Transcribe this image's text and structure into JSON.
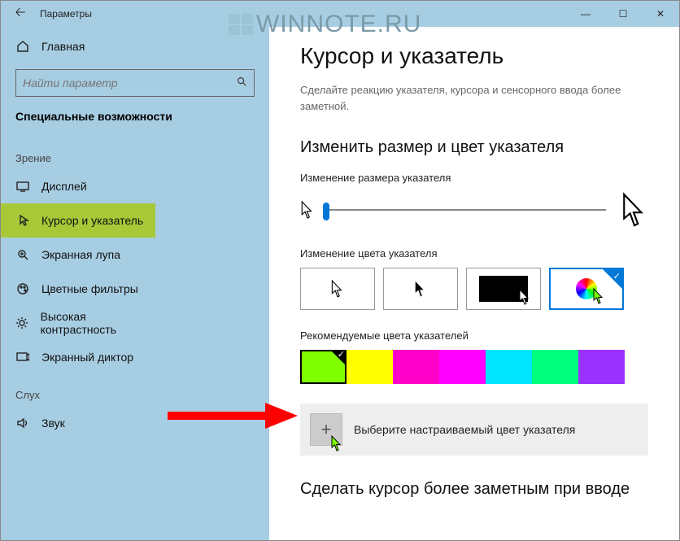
{
  "window": {
    "title": "Параметры"
  },
  "winbuttons": {
    "min": "—",
    "max": "☐",
    "close": "✕"
  },
  "sidebar": {
    "home": "Главная",
    "search_placeholder": "Найти параметр",
    "heading": "Специальные возможности",
    "sub_vision": "Зрение",
    "sub_hearing": "Слух",
    "items": {
      "display": "Дисплей",
      "cursor": "Курсор и указатель",
      "magnifier": "Экранная лупа",
      "color_filters": "Цветные фильтры",
      "high_contrast": "Высокая контрастность",
      "narrator": "Экранный диктор",
      "sound": "Звук"
    }
  },
  "content": {
    "title": "Курсор и указатель",
    "desc": "Сделайте реакцию указателя, курсора и сенсорного ввода более заметной.",
    "h2_size_color": "Изменить размер и цвет указателя",
    "label_size": "Изменение размера указателя",
    "label_color": "Изменение цвета указателя",
    "label_recommended": "Рекомендуемые цвета указателей",
    "custom_color": "Выберите настраиваемый цвет указателя",
    "h2_cursor": "Сделать курсор более заметным при вводе"
  },
  "recommended_colors": [
    "#7FFF00",
    "#FFFF00",
    "#FF00C8",
    "#FF00FF",
    "#00E5FF",
    "#00FF7F",
    "#9932FF"
  ],
  "watermark": "WINNOTE.RU"
}
